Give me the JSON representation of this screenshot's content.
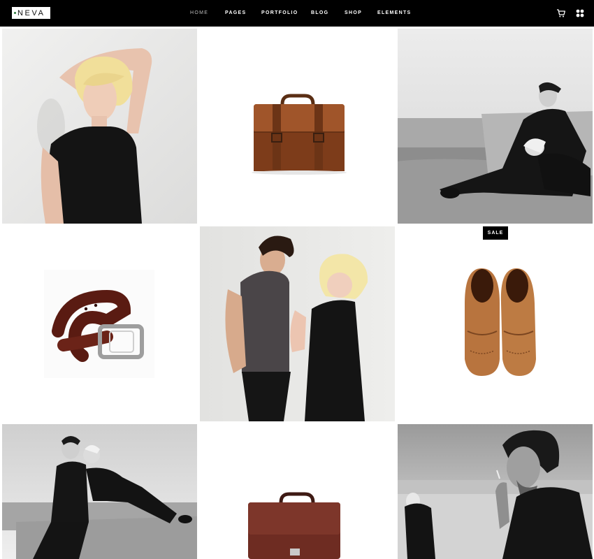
{
  "brand": {
    "logo_text": "NEVA",
    "accent": "#2a7a3a"
  },
  "nav": {
    "items": [
      {
        "label": "HOME",
        "active": true
      },
      {
        "label": "PAGES"
      },
      {
        "label": "PORTFOLIO"
      },
      {
        "label": "BLOG"
      },
      {
        "label": "SHOP"
      },
      {
        "label": "ELEMENTS"
      }
    ],
    "icons": [
      "cart-icon",
      "grid-icon"
    ]
  },
  "grid": {
    "products": [
      {
        "image": "model-blonde-black-top",
        "style": "color"
      },
      {
        "image": "brown-leather-satchel",
        "style": "product"
      },
      {
        "image": "couple-on-beach",
        "style": "bw"
      },
      {
        "image": "brown-leather-belt",
        "style": "product"
      },
      {
        "image": "couple-standing",
        "style": "color"
      },
      {
        "image": "tan-suede-brogues",
        "style": "product",
        "badge": "SALE"
      },
      {
        "image": "couple-sitting-on-wall",
        "style": "bw"
      },
      {
        "image": "burgundy-briefcase",
        "style": "product"
      },
      {
        "image": "man-smoking-beach",
        "style": "bw"
      }
    ]
  }
}
